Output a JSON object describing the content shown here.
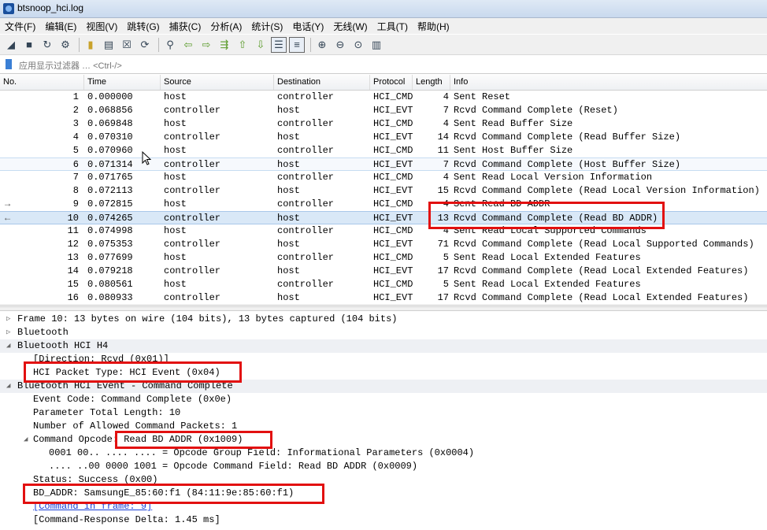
{
  "window": {
    "title": "btsnoop_hci.log"
  },
  "menu": [
    "文件(F)",
    "编辑(E)",
    "视图(V)",
    "跳转(G)",
    "捕获(C)",
    "分析(A)",
    "统计(S)",
    "电话(Y)",
    "无线(W)",
    "工具(T)",
    "帮助(H)"
  ],
  "toolbar": {
    "icons": [
      "shark-fin-start-icon",
      "stop-square-icon",
      "restart-shark-icon",
      "capture-options-gear-icon",
      "open-folder-icon",
      "save-file-icon",
      "close-file-icon",
      "reload-file-icon",
      "find-magnifier-icon",
      "go-back-arrow-icon",
      "go-forward-arrow-icon",
      "go-to-packet-icon",
      "go-first-icon",
      "go-last-icon",
      "autoscroll-icon",
      "colorize-icon",
      "zoom-in-icon",
      "zoom-out-icon",
      "zoom-normal-icon",
      "resize-columns-icon"
    ]
  },
  "filter": {
    "placeholder": "应用显示过滤器 … <Ctrl-/>"
  },
  "packet_list": {
    "columns": [
      "No.",
      "Time",
      "Source",
      "Destination",
      "Protocol",
      "Length",
      "Info"
    ],
    "rows": [
      {
        "no": "1",
        "time": "0.000000",
        "src": "host",
        "dst": "controller",
        "proto": "HCI_CMD",
        "len": "4",
        "info": "Sent Reset"
      },
      {
        "no": "2",
        "time": "0.068856",
        "src": "controller",
        "dst": "host",
        "proto": "HCI_EVT",
        "len": "7",
        "info": "Rcvd Command Complete (Reset)"
      },
      {
        "no": "3",
        "time": "0.069848",
        "src": "host",
        "dst": "controller",
        "proto": "HCI_CMD",
        "len": "4",
        "info": "Sent Read Buffer Size"
      },
      {
        "no": "4",
        "time": "0.070310",
        "src": "controller",
        "dst": "host",
        "proto": "HCI_EVT",
        "len": "14",
        "info": "Rcvd Command Complete (Read Buffer Size)"
      },
      {
        "no": "5",
        "time": "0.070960",
        "src": "host",
        "dst": "controller",
        "proto": "HCI_CMD",
        "len": "11",
        "info": "Sent Host Buffer Size"
      },
      {
        "no": "6",
        "time": "0.071314",
        "src": "controller",
        "dst": "host",
        "proto": "HCI_EVT",
        "len": "7",
        "info": "Rcvd Command Complete (Host Buffer Size)"
      },
      {
        "no": "7",
        "time": "0.071765",
        "src": "host",
        "dst": "controller",
        "proto": "HCI_CMD",
        "len": "4",
        "info": "Sent Read Local Version Information"
      },
      {
        "no": "8",
        "time": "0.072113",
        "src": "controller",
        "dst": "host",
        "proto": "HCI_EVT",
        "len": "15",
        "info": "Rcvd Command Complete (Read Local Version Information)"
      },
      {
        "no": "9",
        "time": "0.072815",
        "src": "host",
        "dst": "controller",
        "proto": "HCI_CMD",
        "len": "4",
        "info": "Sent Read BD ADDR"
      },
      {
        "no": "10",
        "time": "0.074265",
        "src": "controller",
        "dst": "host",
        "proto": "HCI_EVT",
        "len": "13",
        "info": "Rcvd Command Complete (Read BD ADDR)"
      },
      {
        "no": "11",
        "time": "0.074998",
        "src": "host",
        "dst": "controller",
        "proto": "HCI_CMD",
        "len": "4",
        "info": "Sent Read Local Supported Commands"
      },
      {
        "no": "12",
        "time": "0.075353",
        "src": "controller",
        "dst": "host",
        "proto": "HCI_EVT",
        "len": "71",
        "info": "Rcvd Command Complete (Read Local Supported Commands)"
      },
      {
        "no": "13",
        "time": "0.077699",
        "src": "host",
        "dst": "controller",
        "proto": "HCI_CMD",
        "len": "5",
        "info": "Sent Read Local Extended Features"
      },
      {
        "no": "14",
        "time": "0.079218",
        "src": "controller",
        "dst": "host",
        "proto": "HCI_EVT",
        "len": "17",
        "info": "Rcvd Command Complete (Read Local Extended Features)"
      },
      {
        "no": "15",
        "time": "0.080561",
        "src": "host",
        "dst": "controller",
        "proto": "HCI_CMD",
        "len": "5",
        "info": "Sent Read Local Extended Features"
      },
      {
        "no": "16",
        "time": "0.080933",
        "src": "controller",
        "dst": "host",
        "proto": "HCI_EVT",
        "len": "17",
        "info": "Rcvd Command Complete (Read Local Extended Features)"
      }
    ]
  },
  "details": [
    {
      "text": "Frame 10: 13 bytes on wire (104 bits), 13 bytes captured (104 bits)",
      "tri": "▷"
    },
    {
      "text": "Bluetooth",
      "tri": "▷"
    },
    {
      "text": "Bluetooth HCI H4",
      "tri": "◢"
    },
    {
      "text": "[Direction: Rcvd (0x01)]",
      "tri": ""
    },
    {
      "text": "HCI Packet Type: HCI Event (0x04)",
      "tri": ""
    },
    {
      "text": "Bluetooth HCI Event - Command Complete",
      "tri": "◢"
    },
    {
      "text": "Event Code: Command Complete (0x0e)",
      "tri": ""
    },
    {
      "text": "Parameter Total Length: 10",
      "tri": ""
    },
    {
      "text": "Number of Allowed Command Packets: 1",
      "tri": ""
    },
    {
      "text": "Command Opcode: Read BD ADDR (0x1009)",
      "tri": "◢"
    },
    {
      "text": "0001 00.. .... .... = Opcode Group Field: Informational Parameters (0x0004)",
      "tri": ""
    },
    {
      "text": ".... ..00 0000 1001 = Opcode Command Field: Read BD ADDR (0x0009)",
      "tri": ""
    },
    {
      "text": "Status: Success (0x00)",
      "tri": ""
    },
    {
      "text": "BD_ADDR: SamsungE_85:60:f1 (84:11:9e:85:60:f1)",
      "tri": ""
    },
    {
      "text": "[Command in frame: 9]",
      "tri": ""
    },
    {
      "text": "[Command-Response Delta: 1.45 ms]",
      "tri": ""
    }
  ],
  "colors": {
    "annotation_red": "#e21010",
    "selected_row": "#d9e8f7",
    "link": "#1a3fd6"
  }
}
